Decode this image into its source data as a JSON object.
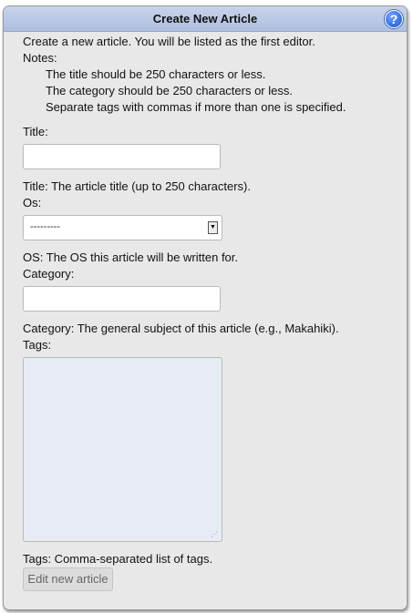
{
  "header": {
    "title": "Create New Article",
    "help_icon": "help-icon",
    "help_glyph": "?"
  },
  "intro": "Create a new article. You will be listed as the first editor.",
  "notes_label": "Notes:",
  "notes": [
    "The title should be 250 characters or less.",
    "The category should be 250 characters or less.",
    "Separate tags with commas if more than one is specified."
  ],
  "fields": {
    "title": {
      "label": "Title:",
      "value": "",
      "help": "Title: The article title (up to 250 characters)."
    },
    "os": {
      "label": "Os:",
      "selected": "---------",
      "help": "OS: The OS this article will be written for."
    },
    "category": {
      "label": "Category:",
      "value": "",
      "help": "Category: The general subject of this article (e.g., Makahiki)."
    },
    "tags": {
      "label": "Tags:",
      "value": "",
      "help": "Tags: Comma-separated list of tags."
    }
  },
  "submit_label": "Edit new article",
  "colors": {
    "header_bg": "#b7c6e3",
    "panel_bg": "#e8e8e8",
    "help_icon": "#2b62d6",
    "tags_bg": "#e6ebf4"
  }
}
